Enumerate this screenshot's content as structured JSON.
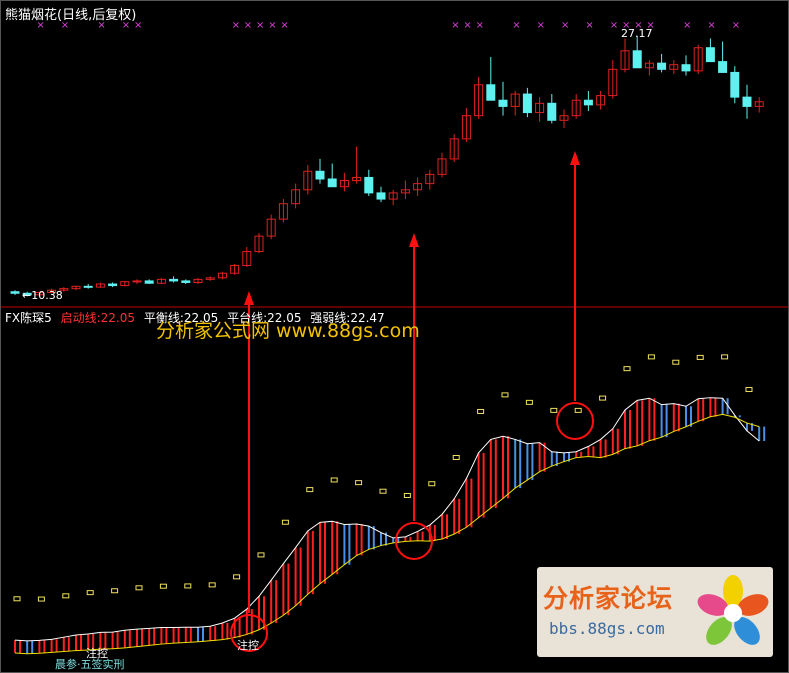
{
  "title": "熊猫烟花(日线,后复权)",
  "colors": {
    "up": "#e02020",
    "down": "#5ff0f0",
    "background": "#000000",
    "divider": "#c00000",
    "highlight": "#ff1010",
    "signal": "#e040e0"
  },
  "price_labels": {
    "low": "←10.38",
    "high": "27.17"
  },
  "indicator": {
    "name": "FX陈琛5",
    "qidong": "启动线:22.05",
    "pingheng": "平衡线:22.05",
    "pingtai": "平台线:22.05",
    "qiangruo": "强弱线:22.47"
  },
  "watermark": "分析家公式网 www.88gs.com",
  "forum": {
    "name": "分析家论坛",
    "url": "bbs.88gs.com"
  },
  "bottom_label": "注控",
  "bottom_text": "晨参·五签实刑",
  "bottom_small": "注控",
  "chart_data": {
    "type": "candlestick",
    "candles": [
      [
        10.6,
        10.7,
        10.4,
        10.5
      ],
      [
        10.5,
        10.6,
        10.3,
        10.4
      ],
      [
        10.4,
        10.6,
        10.38,
        10.55
      ],
      [
        10.55,
        10.8,
        10.5,
        10.7
      ],
      [
        10.7,
        10.9,
        10.6,
        10.8
      ],
      [
        10.8,
        11.0,
        10.7,
        10.95
      ],
      [
        10.95,
        11.1,
        10.8,
        10.9
      ],
      [
        10.9,
        11.2,
        10.85,
        11.1
      ],
      [
        11.1,
        11.2,
        10.9,
        11.0
      ],
      [
        11.0,
        11.3,
        10.95,
        11.25
      ],
      [
        11.25,
        11.4,
        11.1,
        11.3
      ],
      [
        11.3,
        11.4,
        11.1,
        11.15
      ],
      [
        11.15,
        11.5,
        11.1,
        11.4
      ],
      [
        11.4,
        11.6,
        11.2,
        11.3
      ],
      [
        11.3,
        11.4,
        11.1,
        11.2
      ],
      [
        11.2,
        11.5,
        11.1,
        11.4
      ],
      [
        11.4,
        11.6,
        11.3,
        11.5
      ],
      [
        11.5,
        11.9,
        11.4,
        11.8
      ],
      [
        11.8,
        12.4,
        11.7,
        12.3
      ],
      [
        12.3,
        13.5,
        12.2,
        13.2
      ],
      [
        13.2,
        14.4,
        13.1,
        14.2
      ],
      [
        14.2,
        15.6,
        14.0,
        15.3
      ],
      [
        15.3,
        16.6,
        15.1,
        16.3
      ],
      [
        16.3,
        17.6,
        16.0,
        17.2
      ],
      [
        17.2,
        18.8,
        16.9,
        18.4
      ],
      [
        18.4,
        19.2,
        17.6,
        17.9
      ],
      [
        17.9,
        18.9,
        17.5,
        17.4
      ],
      [
        17.4,
        18.3,
        17.1,
        17.8
      ],
      [
        17.8,
        20.0,
        17.6,
        18.0
      ],
      [
        18.0,
        18.5,
        16.8,
        17.0
      ],
      [
        17.0,
        17.4,
        16.4,
        16.6
      ],
      [
        16.6,
        17.2,
        16.2,
        17.0
      ],
      [
        17.0,
        17.8,
        16.6,
        17.2
      ],
      [
        17.2,
        18.0,
        16.8,
        17.6
      ],
      [
        17.6,
        18.5,
        17.2,
        18.2
      ],
      [
        18.2,
        19.6,
        18.0,
        19.2
      ],
      [
        19.2,
        20.8,
        19.0,
        20.5
      ],
      [
        20.5,
        22.5,
        20.3,
        22.0
      ],
      [
        22.0,
        24.5,
        21.8,
        24.0
      ],
      [
        24.0,
        25.8,
        23.4,
        23.0
      ],
      [
        23.0,
        24.2,
        22.0,
        22.6
      ],
      [
        22.6,
        23.6,
        22.0,
        23.4
      ],
      [
        23.4,
        23.8,
        21.9,
        22.2
      ],
      [
        22.2,
        23.2,
        21.6,
        22.8
      ],
      [
        22.8,
        23.4,
        21.5,
        21.7
      ],
      [
        21.7,
        22.4,
        21.2,
        22.0
      ],
      [
        22.0,
        23.4,
        21.8,
        23.0
      ],
      [
        23.0,
        23.6,
        22.3,
        22.7
      ],
      [
        22.7,
        23.6,
        22.4,
        23.3
      ],
      [
        23.3,
        25.6,
        23.1,
        25.0
      ],
      [
        25.0,
        27.0,
        24.8,
        26.2
      ],
      [
        26.2,
        27.17,
        25.5,
        25.1
      ],
      [
        25.1,
        25.6,
        24.6,
        25.4
      ],
      [
        25.4,
        26.0,
        24.8,
        25.0
      ],
      [
        25.0,
        25.6,
        24.7,
        25.3
      ],
      [
        25.3,
        25.9,
        24.6,
        24.9
      ],
      [
        24.9,
        26.6,
        24.7,
        26.4
      ],
      [
        26.4,
        27.0,
        25.6,
        25.5
      ],
      [
        25.5,
        26.8,
        24.8,
        24.8
      ],
      [
        24.8,
        25.2,
        22.8,
        23.2
      ],
      [
        23.2,
        24.0,
        21.8,
        22.6
      ],
      [
        22.6,
        23.2,
        22.2,
        22.9
      ]
    ],
    "signal_days": [
      2,
      4,
      7,
      9,
      10,
      18,
      19,
      20,
      21,
      22,
      36,
      37,
      38,
      41,
      43,
      45,
      47,
      49,
      50,
      51,
      52,
      55,
      57,
      59
    ]
  }
}
